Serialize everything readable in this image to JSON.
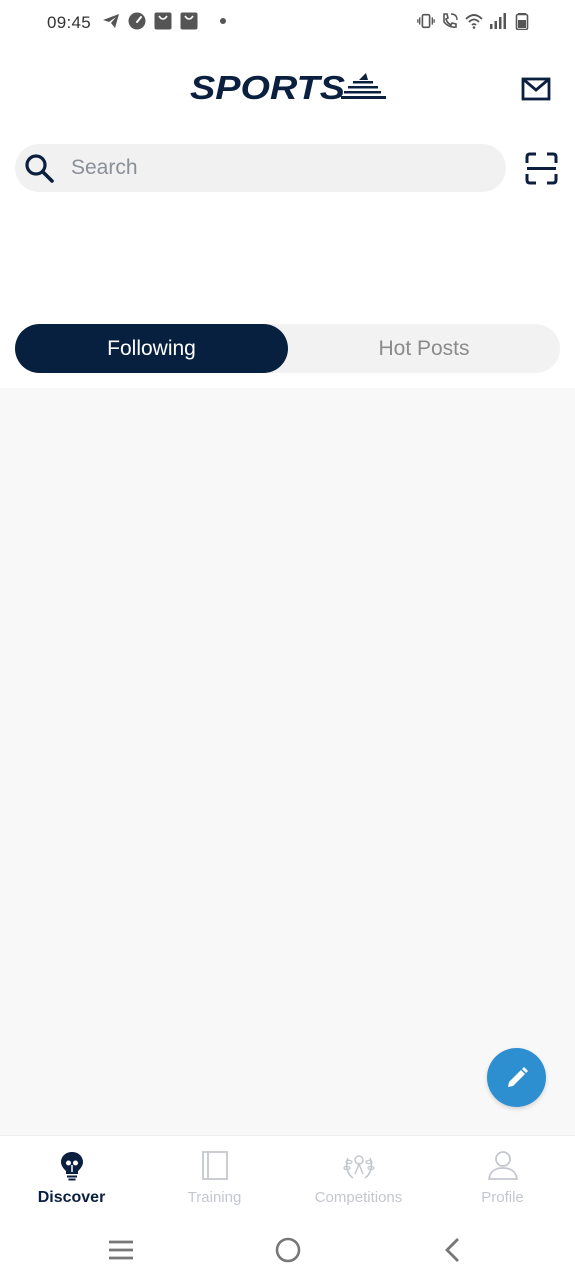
{
  "status_bar": {
    "time": "09:45",
    "left_icons": [
      "telegram-icon",
      "speedometer-icon",
      "shopping-bag-icon",
      "shopping-bag-icon",
      "dot-icon"
    ],
    "right_icons": [
      "vibrate-icon",
      "wifi-call-icon",
      "wifi-icon",
      "signal-icon",
      "battery-icon"
    ]
  },
  "header": {
    "logo_text": "SPORTS",
    "mail_icon": "mail-icon"
  },
  "search": {
    "placeholder": "Search",
    "value": ""
  },
  "tabs": [
    {
      "label": "Following",
      "active": true
    },
    {
      "label": "Hot Posts",
      "active": false
    }
  ],
  "bottom_nav": [
    {
      "label": "Discover",
      "icon": "lightbulb-icon",
      "active": true
    },
    {
      "label": "Training",
      "icon": "notebook-icon",
      "active": false
    },
    {
      "label": "Competitions",
      "icon": "laurel-icon",
      "active": false
    },
    {
      "label": "Profile",
      "icon": "person-icon",
      "active": false
    }
  ],
  "colors": {
    "primary": "#07203f",
    "accent": "#2d8ed0",
    "inactive": "#c4c8ce"
  }
}
